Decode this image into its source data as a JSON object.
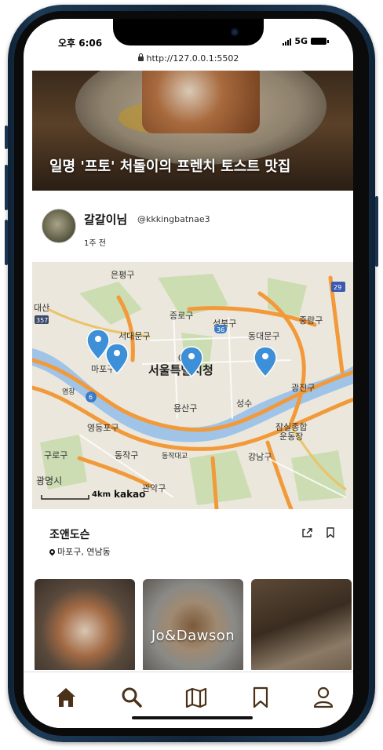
{
  "status_bar": {
    "time": "오후 6:06",
    "network": "5G"
  },
  "browser": {
    "url": "http://127.0.0.1:5502"
  },
  "hero": {
    "title": "일명 '프토' 처돌이의 프렌치 토스트 맛집"
  },
  "author": {
    "name": "갈갈이님",
    "handle": "@kkkingbatnae3",
    "time_ago": "1주 전"
  },
  "map": {
    "center_label": "서울특별시청",
    "districts": [
      "은평구",
      "종로구",
      "성북구",
      "중랑구",
      "서대문구",
      "동대문구",
      "마포구",
      "광진구",
      "용산구",
      "성수",
      "영등포구",
      "동작구",
      "강남구",
      "잠실종합운동장",
      "광명시",
      "관악구",
      "동작대교",
      "대산",
      "염창",
      "구로구"
    ],
    "scale_label": "4km",
    "provider": "kakao",
    "route_numbers": [
      "357",
      "36",
      "6",
      "29"
    ],
    "marker_count": 4
  },
  "place": {
    "name": "조앤도슨",
    "location": "마포구, 연남동"
  },
  "gallery": {
    "overlay_text": "Jo&Dawson"
  },
  "nav": {
    "items": [
      {
        "icon": "home-icon",
        "active": true
      },
      {
        "icon": "search-icon",
        "active": false
      },
      {
        "icon": "map-icon",
        "active": false
      },
      {
        "icon": "bookmark-icon",
        "active": false
      },
      {
        "icon": "user-icon",
        "active": false
      }
    ]
  },
  "colors": {
    "accent": "#4a3118",
    "marker": "#3d8fd8",
    "river": "#9fc4e8",
    "road": "#f29a3a"
  }
}
